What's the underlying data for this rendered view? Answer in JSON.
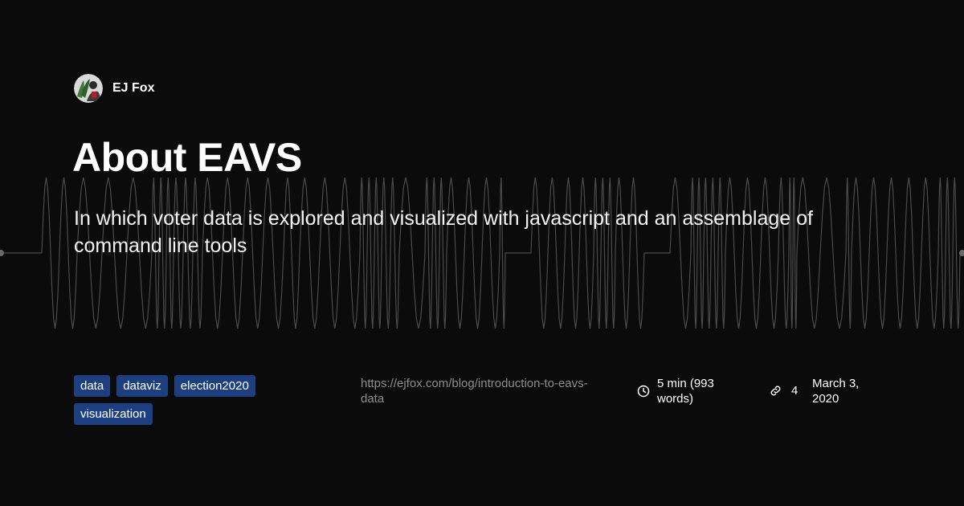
{
  "author": {
    "name": "EJ Fox",
    "avatar_icon": "avatar-illustration"
  },
  "post": {
    "title": "About EAVS",
    "subtitle": "In which voter data is explored and visualized with javascript and an assemblage of command line tools",
    "url": "https://ejfox.com/blog/introduction-to-eavs-data",
    "reading_time": "5 min (993 words)",
    "links_count": "4",
    "date": "March 3, 2020"
  },
  "tags": [
    "data",
    "dataviz",
    "election2020",
    "visualization"
  ],
  "icons": {
    "reading_time": "clock-icon",
    "links": "link-icon"
  },
  "colors": {
    "background": "#0b0b0b",
    "tag_background": "#1e3f7f",
    "waveform": "#4a4a4a",
    "url_text": "#8c8c8c"
  }
}
